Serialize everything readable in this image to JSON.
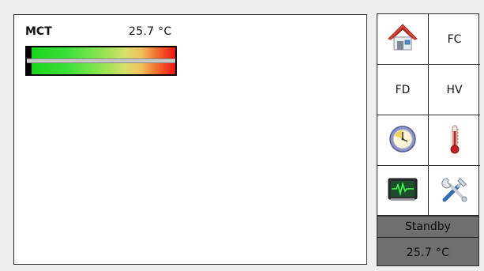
{
  "gauge": {
    "label": "MCT",
    "value": "25.7 °C",
    "level": 0.03
  },
  "nav": {
    "items": [
      {
        "label": "",
        "icon": "home-icon"
      },
      {
        "label": "FC",
        "icon": ""
      },
      {
        "label": "FD",
        "icon": ""
      },
      {
        "label": "HV",
        "icon": ""
      },
      {
        "label": "",
        "icon": "clock-icon"
      },
      {
        "label": "",
        "icon": "thermometer-icon"
      },
      {
        "label": "",
        "icon": "monitor-icon"
      },
      {
        "label": "",
        "icon": "tools-icon"
      }
    ]
  },
  "status": {
    "state": "Standby",
    "temperature": "25.7 °C"
  }
}
